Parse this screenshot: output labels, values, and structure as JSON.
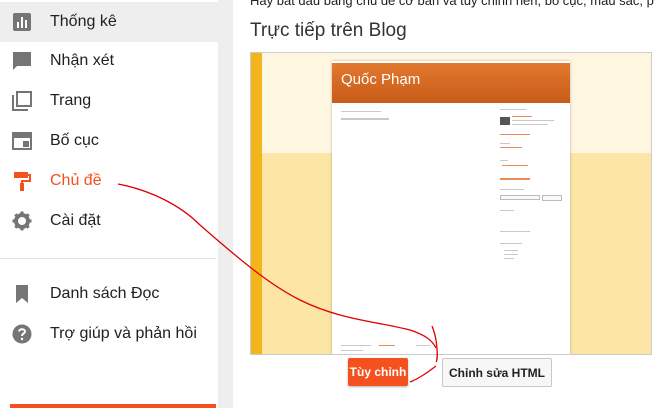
{
  "sidebar": {
    "items": [
      {
        "label": "Thống kê",
        "icon": "bar-chart-icon"
      },
      {
        "label": "Nhận xét",
        "icon": "comment-icon"
      },
      {
        "label": "Trang",
        "icon": "pages-icon"
      },
      {
        "label": "Bố cục",
        "icon": "layout-icon"
      },
      {
        "label": "Chủ đề",
        "icon": "paint-roller-icon",
        "active": true
      },
      {
        "label": "Cài đặt",
        "icon": "gear-icon"
      },
      {
        "label": "Danh sách Đọc",
        "icon": "bookmark-icon"
      },
      {
        "label": "Trợ giúp và phản hồi",
        "icon": "help-icon"
      }
    ]
  },
  "main": {
    "intro_text": "Hãy bắt đầu bằng chủ đề cơ bản và tùy chỉnh nền, bố cục, màu sắc, p",
    "live_title": "Trực tiếp trên Blog",
    "preview": {
      "blog_title": "Quốc Phạm"
    },
    "buttons": {
      "customize": "Tùy chỉnh",
      "edit_html": "Chỉnh sửa HTML"
    }
  },
  "colors": {
    "accent": "#f4511e",
    "preview_header": "#d86a22",
    "preview_background": "#fde5a6",
    "annotation": "#e00000"
  }
}
